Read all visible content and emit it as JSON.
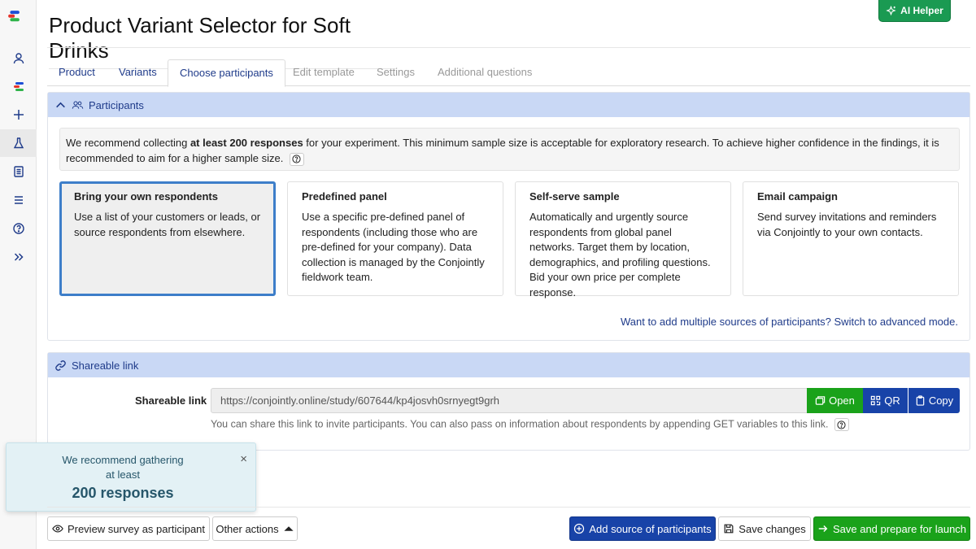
{
  "app": {
    "title": "Product Variant Selector for Soft Drinks",
    "ai_helper_label": "AI Helper"
  },
  "rail": [
    "user-icon",
    "logo-small-icon",
    "plus-icon",
    "flask-icon",
    "document-icon",
    "menu-icon",
    "help-icon",
    "expand-icon"
  ],
  "tabs": [
    {
      "label": "Product",
      "state": "link"
    },
    {
      "label": "Variants",
      "state": "link"
    },
    {
      "label": "Choose participants",
      "state": "active"
    },
    {
      "label": "Edit template",
      "state": "disabled"
    },
    {
      "label": "Settings",
      "state": "disabled"
    },
    {
      "label": "Additional questions",
      "state": "disabled"
    }
  ],
  "participants": {
    "heading": "Participants",
    "notice_before": "We recommend collecting ",
    "notice_bold": "at least 200 responses",
    "notice_after": " for your experiment. This minimum sample size is acceptable for exploratory research. To achieve higher confidence in the findings, it is recommended to aim for a higher sample size.",
    "cards": [
      {
        "title": "Bring your own respondents",
        "desc": "Use a list of your customers or leads, or source respondents from elsewhere.",
        "selected": true
      },
      {
        "title": "Predefined panel",
        "desc": "Use a specific pre-defined panel of respondents (including those who are pre-defined for your company). Data collection is managed by the Conjointly fieldwork team.",
        "selected": false
      },
      {
        "title": "Self-serve sample",
        "desc": "Automatically and urgently source respondents from global panel networks. Target them by location, demographics, and profiling questions. Bid your own price per complete response.",
        "selected": false
      },
      {
        "title": "Email campaign",
        "desc": "Send survey invitations and reminders via Conjointly to your own contacts.",
        "selected": false
      }
    ],
    "advanced_link": "Want to add multiple sources of participants? Switch to advanced mode."
  },
  "share": {
    "heading": "Shareable link",
    "label": "Shareable link",
    "url": "https://conjointly.online/study/607644/kp4josvh0srnyegt9grh",
    "open_label": "Open",
    "qr_label": "QR",
    "copy_label": "Copy",
    "help": "You can share this link to invite participants. You can also pass on information about respondents by appending GET variables to this link."
  },
  "toast": {
    "line1": "We recommend gathering",
    "line2": "at least",
    "line3": "200 responses",
    "close": "×"
  },
  "footer": {
    "preview_label": "Preview survey as participant",
    "other_label": "Other actions",
    "add_source_label": "Add source of participants",
    "save_label": "Save changes",
    "launch_label": "Save and prepare for launch"
  },
  "colors": {
    "brand_blue": "#1843a8",
    "panel_header": "#c9d8f5",
    "green": "#1aa21a",
    "selected_border": "#3d7ec9"
  }
}
